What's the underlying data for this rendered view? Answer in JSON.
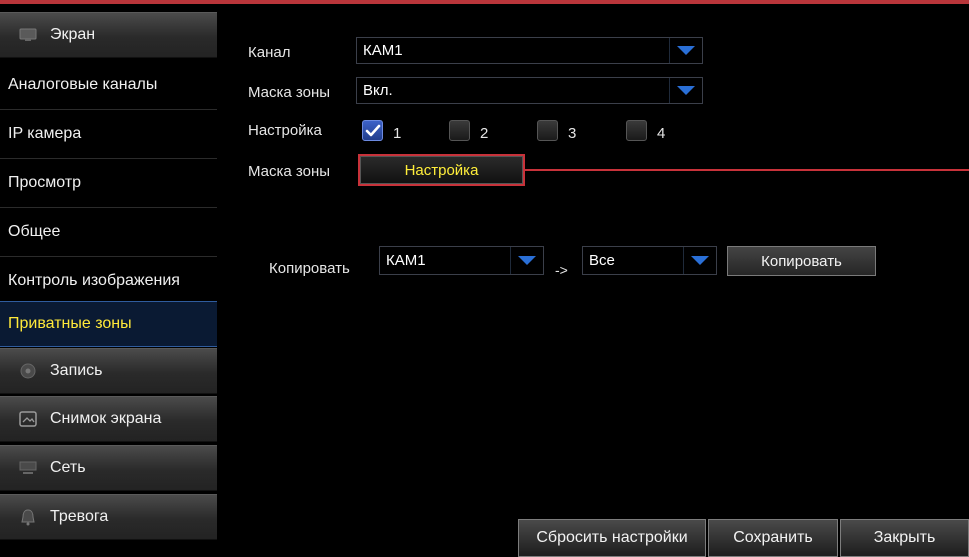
{
  "sidebar": {
    "category_screen": "Экран",
    "items": [
      {
        "label": "Аналоговые каналы"
      },
      {
        "label": "IP камера"
      },
      {
        "label": "Просмотр"
      },
      {
        "label": "Общее"
      },
      {
        "label": "Контроль изображения"
      },
      {
        "label": "Приватные зоны"
      }
    ],
    "categories": [
      {
        "label": "Запись",
        "icon": "record-icon"
      },
      {
        "label": "Снимок экрана",
        "icon": "snapshot-icon"
      },
      {
        "label": "Сеть",
        "icon": "network-icon"
      },
      {
        "label": "Тревога",
        "icon": "alarm-icon"
      }
    ]
  },
  "form": {
    "channel_label": "Канал",
    "channel_value": "КАМ1",
    "mask_label": "Маска зоны",
    "mask_value": "Вкл.",
    "setup_label": "Настройка",
    "zones": [
      {
        "label": "1",
        "checked": true
      },
      {
        "label": "2",
        "checked": false
      },
      {
        "label": "3",
        "checked": false
      },
      {
        "label": "4",
        "checked": false
      }
    ],
    "mask_setup_label": "Маска зоны",
    "mask_setup_button": "Настройка"
  },
  "copy": {
    "label": "Копировать",
    "from_value": "КАМ1",
    "arrow": "->",
    "to_value": "Все",
    "button": "Копировать"
  },
  "footer": {
    "reset": "Сбросить настройки",
    "save": "Сохранить",
    "close": "Закрыть"
  },
  "colors": {
    "accent_yellow": "#ffe93a",
    "dropdown_arrow": "#2a6fd6",
    "highlight_red": "#c8323a"
  }
}
